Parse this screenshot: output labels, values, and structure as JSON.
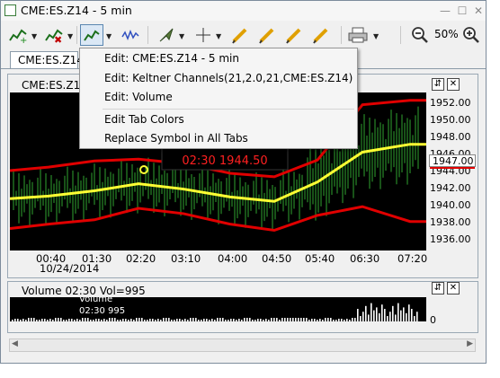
{
  "window": {
    "title": "CME:ES.Z14 - 5 min",
    "minimize": "—",
    "maximize": "☐",
    "close": "✕"
  },
  "toolbar": {
    "icons": [
      "add-chart-icon",
      "remove-chart-icon",
      "edit-chart-icon",
      "wave-icon",
      "cursor-icon",
      "crosshair-icon",
      "pen-icon",
      "pen-icon",
      "pen-icon",
      "pen-icon",
      "print-icon"
    ],
    "zoom_label": "50%"
  },
  "tab": {
    "label": "CME:ES.Z14"
  },
  "price_panel": {
    "header": "CME:ES.Z14",
    "current_price": "1947.00",
    "tooltip": "02:30 1944.50",
    "y_ticks": [
      "1952.00",
      "1950.00",
      "1948.00",
      "1946.00",
      "1944.00",
      "1942.00",
      "1940.00",
      "1938.00",
      "1936.00"
    ],
    "x_ticks": [
      "00:40",
      "01:30",
      "02:20",
      "03:10",
      "04:00",
      "04:50",
      "05:40",
      "06:30",
      "07:20"
    ],
    "date": "10/24/2014"
  },
  "volume_panel": {
    "header": "Volume 02:30 Vol=995",
    "tooltip_line1": "Volume",
    "tooltip_line2": "02:30 995",
    "y_tick": "0"
  },
  "context_menu": {
    "items": [
      "Edit: CME:ES.Z14 - 5 min",
      "Edit: Keltner Channels(21,2.0,21,CME:ES.Z14)",
      "Edit: Volume",
      "Edit Tab Colors",
      "Replace Symbol in All Tabs"
    ]
  },
  "panel_buttons": {
    "swap": "⇵",
    "close": "✕"
  },
  "scrollbar": {
    "left": "◀",
    "right": "▶"
  },
  "colors": {
    "keltner_band": "#e00000",
    "keltner_mid": "#ffff33",
    "price_bars": "#2fa52f",
    "tooltip_text": "#ff2020",
    "volume_bars": "#ffffff"
  },
  "chart_data": {
    "type": "line",
    "x": [
      "00:40",
      "01:30",
      "02:20",
      "03:10",
      "04:00",
      "04:50",
      "05:40",
      "06:30",
      "07:20"
    ],
    "ylim": [
      1935,
      1953
    ],
    "series": [
      {
        "values": [
          1941.2,
          1941.8,
          1942.6,
          1942.0,
          1941.1,
          1940.6,
          1942.8,
          1946.2,
          1947.1
        ]
      },
      {
        "values": [
          1944.5,
          1945.2,
          1945.4,
          1944.9,
          1943.8,
          1943.4,
          1945.3,
          1951.6,
          1952.1
        ]
      },
      {
        "values": [
          1938.0,
          1938.5,
          1939.8,
          1939.2,
          1938.0,
          1937.3,
          1939.0,
          1940.0,
          1938.3
        ]
      }
    ]
  }
}
